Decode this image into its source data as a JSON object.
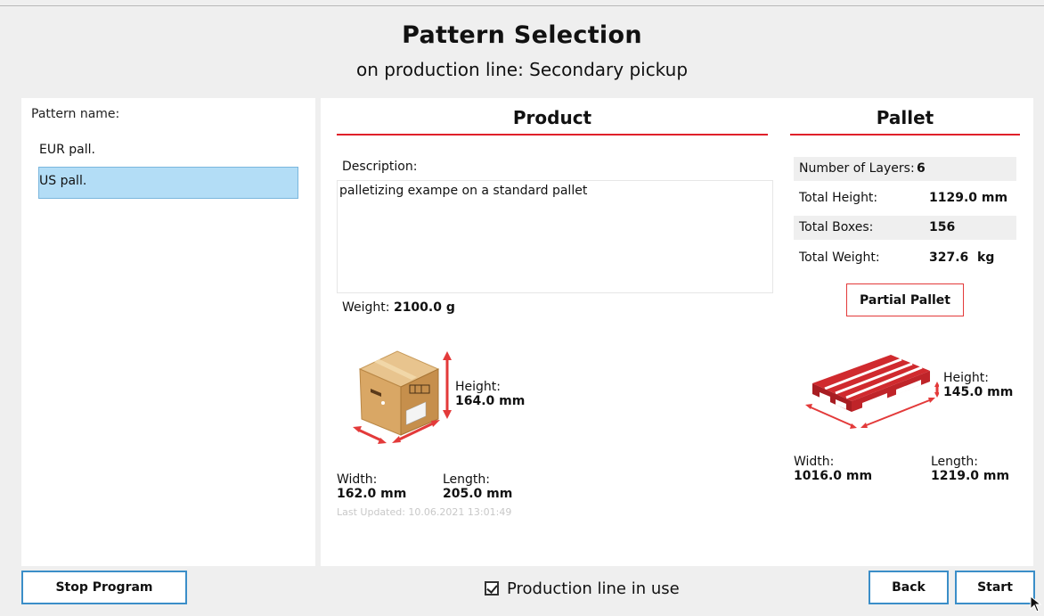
{
  "header": {
    "title": "Pattern Selection",
    "subtitle": "on production line: Secondary pickup"
  },
  "patterns": {
    "label": "Pattern name:",
    "items": [
      {
        "name": "EUR pall.",
        "selected": false
      },
      {
        "name": "US pall.",
        "selected": true
      }
    ]
  },
  "product": {
    "title": "Product",
    "description_label": "Description:",
    "description": "palletizing exampe on a standard pallet",
    "weight_label": "Weight:",
    "weight_value": "2100.0 g",
    "height_label": "Height:",
    "height_value": "164.0 mm",
    "width_label": "Width:",
    "width_value": "162.0 mm",
    "length_label": "Length:",
    "length_value": "205.0 mm",
    "last_updated": "Last Updated: 10.06.2021 13:01:49"
  },
  "pallet": {
    "title": "Pallet",
    "stats": [
      {
        "label": "Number of Layers:",
        "value": "6"
      },
      {
        "label": "Total Height:",
        "value": "1129.0 mm"
      },
      {
        "label": "Total Boxes:",
        "value": "156"
      },
      {
        "label": "Total Weight:",
        "value": "327.6  kg"
      }
    ],
    "partial_button": "Partial Pallet",
    "height_label": "Height:",
    "height_value": "145.0 mm",
    "width_label": "Width:",
    "width_value": "1016.0 mm",
    "length_label": "Length:",
    "length_value": "1219.0 mm"
  },
  "footer": {
    "stop_label": "Stop Program",
    "production_line_label": "Production line in use",
    "production_line_checked": true,
    "back_label": "Back",
    "start_label": "Start"
  },
  "colors": {
    "accent_red": "#e0202a",
    "button_border": "#3b8ec8",
    "selection": "#b3ddf6"
  }
}
